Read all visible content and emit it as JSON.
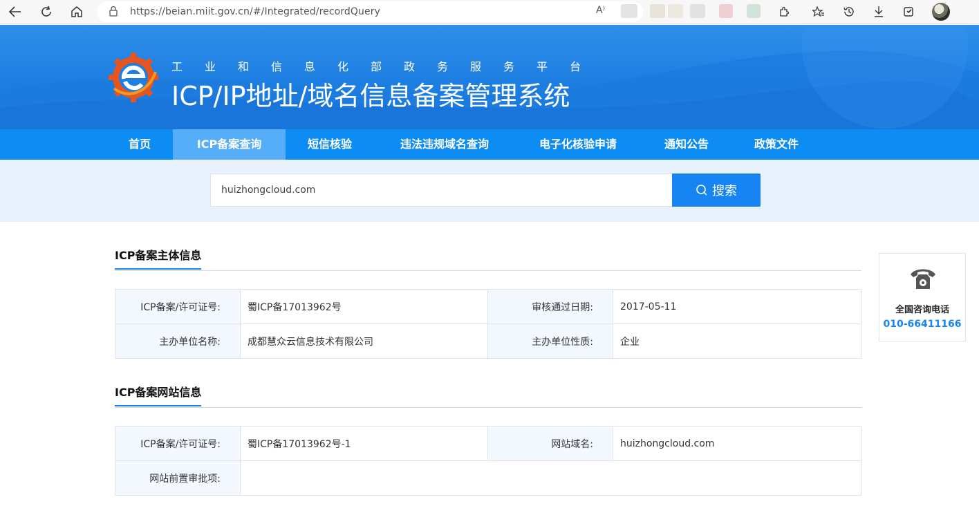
{
  "browser": {
    "url": "https://beian.miit.gov.cn/#/Integrated/recordQuery",
    "read_aloud": "A⁾"
  },
  "header": {
    "subtitle": "工业和信息化部政务服务平台",
    "title": "ICP/IP地址/域名信息备案管理系统"
  },
  "nav": {
    "items": [
      {
        "label": "首页"
      },
      {
        "label": "ICP备案查询"
      },
      {
        "label": "短信核验"
      },
      {
        "label": "违法违规域名查询"
      },
      {
        "label": "电子化核验申请"
      },
      {
        "label": "通知公告"
      },
      {
        "label": "政策文件"
      }
    ],
    "active_index": 1
  },
  "search": {
    "value": "huizhongcloud.com",
    "button_label": "搜索"
  },
  "subject_section": {
    "title": "ICP备案主体信息",
    "rows": [
      {
        "label1": "ICP备案/许可证号:",
        "value1": "蜀ICP备17013962号",
        "label2": "审核通过日期:",
        "value2": "2017-05-11"
      },
      {
        "label1": "主办单位名称:",
        "value1": "成都慧众云信息技术有限公司",
        "label2": "主办单位性质:",
        "value2": "企业"
      }
    ]
  },
  "website_section": {
    "title": "ICP备案网站信息",
    "rows": [
      {
        "label1": "ICP备案/许可证号:",
        "value1": "蜀ICP备17013962号-1",
        "label2": "网站域名:",
        "value2": "huizhongcloud.com"
      }
    ],
    "approval_label": "网站前置审批项:",
    "approval_value": ""
  },
  "consult": {
    "label": "全国咨询电话",
    "phone": "010-66411166"
  },
  "colors": {
    "primary": "#1684f3",
    "nav_bg": "#0d8cf3",
    "nav_active": "#55aef7",
    "banner": "#1e7fe3"
  }
}
